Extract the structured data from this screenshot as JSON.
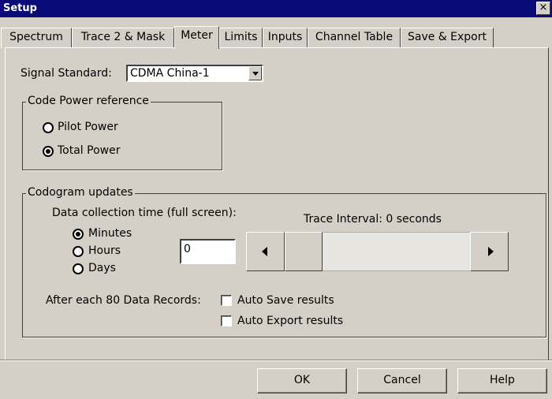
{
  "window": {
    "title": "Setup",
    "close_glyph": "×"
  },
  "tabs": [
    {
      "label": "Spectrum",
      "active": false
    },
    {
      "label": "Trace 2 & Mask",
      "active": false
    },
    {
      "label": "Meter",
      "active": true
    },
    {
      "label": "Limits",
      "active": false
    },
    {
      "label": "Inputs",
      "active": false
    },
    {
      "label": "Channel Table",
      "active": false
    },
    {
      "label": "Save & Export",
      "active": false
    }
  ],
  "signal_standard": {
    "label": "Signal Standard:",
    "value": "CDMA China-1"
  },
  "code_power": {
    "legend": "Code Power reference",
    "options": [
      {
        "label": "Pilot Power",
        "selected": false
      },
      {
        "label": "Total Power",
        "selected": true
      }
    ]
  },
  "codogram": {
    "legend": "Codogram updates",
    "collection_label": "Data collection time (full screen):",
    "units": [
      {
        "label": "Minutes",
        "selected": true
      },
      {
        "label": "Hours",
        "selected": false
      },
      {
        "label": "Days",
        "selected": false
      }
    ],
    "time_value": "0",
    "trace_interval": "Trace Interval: 0 seconds",
    "scroll_position": 0,
    "after_label": "After each 80 Data Records:",
    "auto_save": {
      "label": "Auto Save results",
      "checked": false
    },
    "auto_export": {
      "label": "Auto Export results",
      "checked": false
    }
  },
  "buttons": {
    "ok": "OK",
    "cancel": "Cancel",
    "help": "Help"
  }
}
